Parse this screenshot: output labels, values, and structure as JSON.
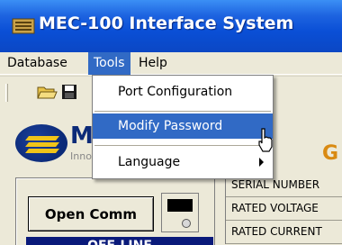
{
  "window": {
    "title": "MEC-100 Interface System",
    "icon": "app-logo-icon",
    "titlebar_color": "#0a4fd6"
  },
  "menubar": {
    "items": [
      {
        "label": "Database"
      },
      {
        "label": "Tools"
      },
      {
        "label": "Help"
      }
    ],
    "active": "Tools",
    "highlight_color": "#316ac5"
  },
  "toolbar": {
    "buttons": [
      {
        "icon": "open-folder-icon"
      },
      {
        "icon": "save-icon"
      }
    ]
  },
  "tools_menu": {
    "items": [
      {
        "label": "Port Configuration"
      },
      {
        "label": "Modify Password"
      },
      {
        "label": "Language",
        "submenu": true
      }
    ],
    "hovered": "Modify Password"
  },
  "logo": {
    "text": "Ma",
    "subtext": "Inno"
  },
  "heading": {
    "text": "G",
    "color": "#d98a12"
  },
  "comm_panel": {
    "button_label": "Open Comm",
    "status": "OFF-LINE",
    "status_bg": "#0a1a7a"
  },
  "info_table": {
    "rows": [
      {
        "label": "SERIAL NUMBER"
      },
      {
        "label": "RATED VOLTAGE"
      },
      {
        "label": "RATED CURRENT"
      }
    ]
  }
}
